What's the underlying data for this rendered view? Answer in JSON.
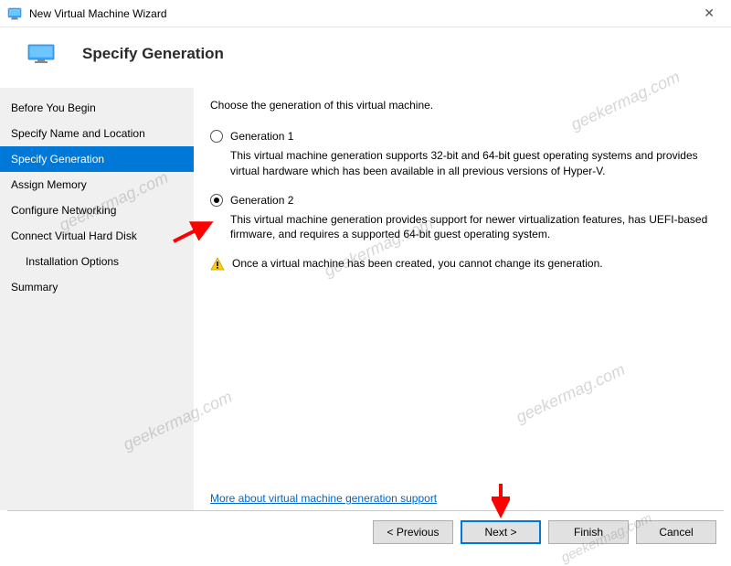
{
  "titlebar": {
    "title": "New Virtual Machine Wizard"
  },
  "header": {
    "title": "Specify Generation"
  },
  "sidebar": {
    "items": [
      {
        "label": "Before You Begin"
      },
      {
        "label": "Specify Name and Location"
      },
      {
        "label": "Specify Generation"
      },
      {
        "label": "Assign Memory"
      },
      {
        "label": "Configure Networking"
      },
      {
        "label": "Connect Virtual Hard Disk"
      },
      {
        "label": "Installation Options"
      },
      {
        "label": "Summary"
      }
    ]
  },
  "content": {
    "prompt": "Choose the generation of this virtual machine.",
    "gen1_label": "Generation 1",
    "gen1_desc": "This virtual machine generation supports 32-bit and 64-bit guest operating systems and provides virtual hardware which has been available in all previous versions of Hyper-V.",
    "gen2_label": "Generation 2",
    "gen2_desc": "This virtual machine generation provides support for newer virtualization features, has UEFI-based firmware, and requires a supported 64-bit guest operating system.",
    "warn_text": "Once a virtual machine has been created, you cannot change its generation.",
    "more_link": "More about virtual machine generation support"
  },
  "footer": {
    "previous": "< Previous",
    "next": "Next >",
    "finish": "Finish",
    "cancel": "Cancel"
  },
  "watermark": "geekermag.com"
}
